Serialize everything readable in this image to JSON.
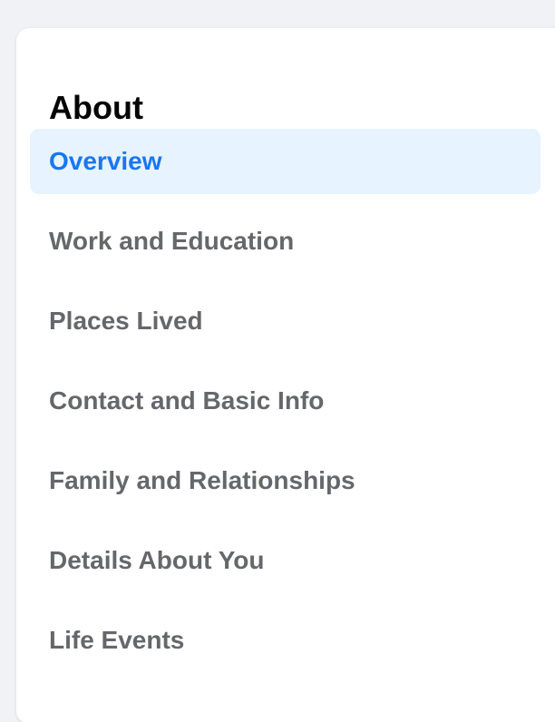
{
  "about": {
    "title": "About",
    "items": [
      {
        "label": "Overview",
        "active": true
      },
      {
        "label": "Work and Education",
        "active": false
      },
      {
        "label": "Places Lived",
        "active": false
      },
      {
        "label": "Contact and Basic Info",
        "active": false
      },
      {
        "label": "Family and Relationships",
        "active": false
      },
      {
        "label": "Details About You",
        "active": false
      },
      {
        "label": "Life Events",
        "active": false
      }
    ]
  },
  "colors": {
    "accent": "#1877f2",
    "active_background": "#e7f3ff",
    "text_secondary": "#65676b",
    "text_primary": "#050505",
    "page_background": "#f0f2f5"
  }
}
